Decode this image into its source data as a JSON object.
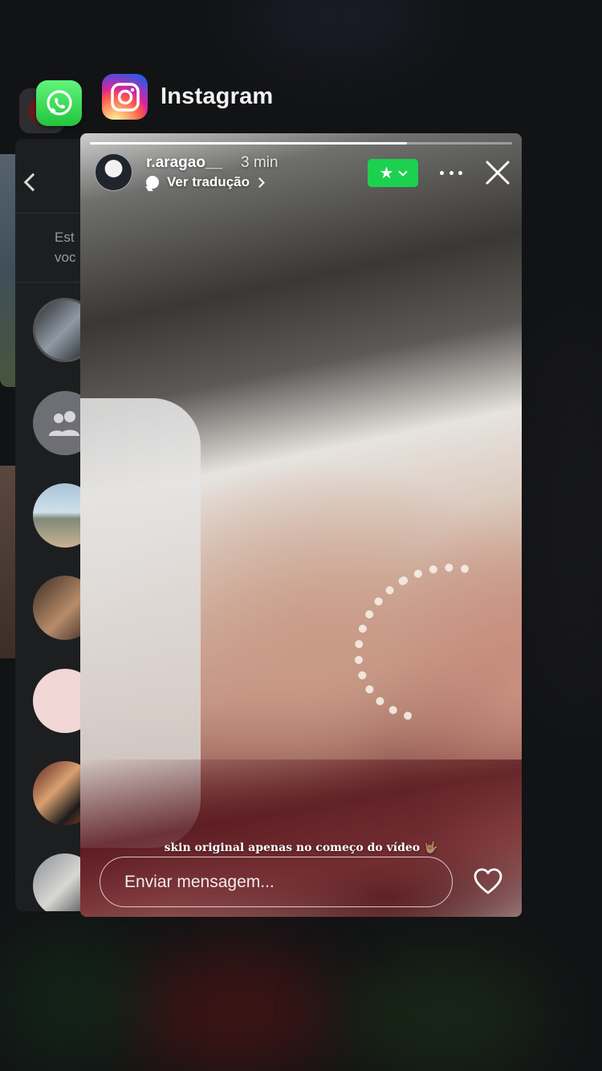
{
  "app_switcher": {
    "app_name": "Instagram",
    "other_apps": [
      "whatsapp-icon",
      "pinterest-icon"
    ]
  },
  "background_card": {
    "text_fragment": [
      "Est",
      "voc"
    ]
  },
  "story": {
    "username": "r.aragao__",
    "timestamp": "3 min",
    "translate_label": "Ver tradução",
    "progress": 0.75,
    "badge": "close-friends-star",
    "caption": "skin original apenas no começo do vídeo 🤟🏽",
    "message_placeholder": "Enviar mensagem...",
    "colors": {
      "close_friends_green": "#1cd14f",
      "text": "#ffffff"
    }
  }
}
